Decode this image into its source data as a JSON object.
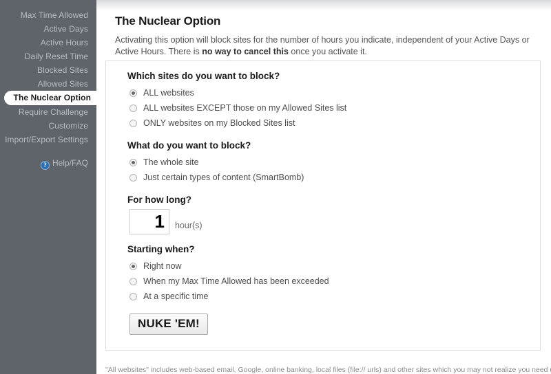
{
  "sidebar": {
    "items": [
      {
        "label": "Max Time Allowed",
        "active": false
      },
      {
        "label": "Active Days",
        "active": false
      },
      {
        "label": "Active Hours",
        "active": false
      },
      {
        "label": "Daily Reset Time",
        "active": false
      },
      {
        "label": "Blocked Sites",
        "active": false
      },
      {
        "label": "Allowed Sites",
        "active": false
      },
      {
        "label": "The Nuclear Option",
        "active": true
      },
      {
        "label": "Require Challenge",
        "active": false
      },
      {
        "label": "Customize",
        "active": false
      },
      {
        "label": "Import/Export Settings",
        "active": false
      }
    ],
    "help": {
      "label": "Help/FAQ",
      "icon": "question-mark-icon",
      "icon_glyph": "?"
    },
    "background_color": "#5e6469",
    "text_color": "#b8bdc1",
    "active_text_color": "#1a1a1a",
    "active_background_color": "#ffffff"
  },
  "header": {
    "title": "The Nuclear Option",
    "intro_part1": "Activating this option will block sites for the number of hours you indicate, independent of your Active Days or Active Hours. There is ",
    "intro_bold": "no way to cancel this",
    "intro_part2": " once you activate it."
  },
  "panel": {
    "questions": [
      {
        "heading": "Which sites do you want to block?",
        "name": "which-sites",
        "options": [
          {
            "label": "ALL websites",
            "checked": true
          },
          {
            "label": "ALL websites EXCEPT those on my Allowed Sites list",
            "checked": false
          },
          {
            "label": "ONLY websites on my Blocked Sites list",
            "checked": false
          }
        ]
      },
      {
        "heading": "What do you want to block?",
        "name": "what-to-block",
        "options": [
          {
            "label": "The whole site",
            "checked": true
          },
          {
            "label": "Just certain types of content (SmartBomb)",
            "checked": false
          }
        ]
      }
    ],
    "duration": {
      "heading": "For how long?",
      "value": "1",
      "unit": "hour(s)"
    },
    "starting": {
      "heading": "Starting when?",
      "name": "starting-when",
      "options": [
        {
          "label": "Right now",
          "checked": true
        },
        {
          "label": "When my Max Time Allowed has been exceeded",
          "checked": false
        },
        {
          "label": "At a specific time",
          "checked": false
        }
      ]
    },
    "submit_label": "NUKE 'EM!"
  },
  "footer": {
    "note": "\"All websites\" includes web-based email, Google, online banking, local files (file:// urls) and other sites which you may not realize you need until it's too late."
  }
}
